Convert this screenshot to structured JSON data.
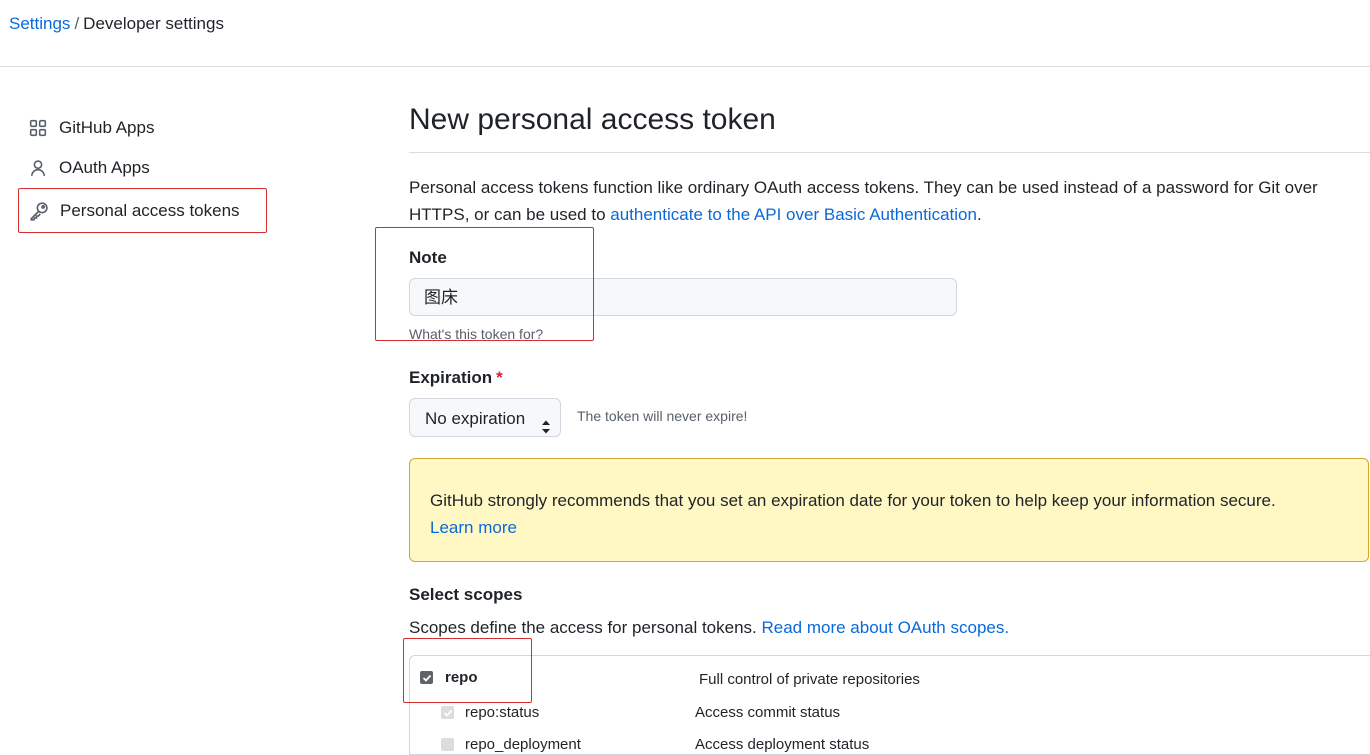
{
  "breadcrumb": {
    "root": "Settings",
    "separator": "/",
    "current": "Developer settings"
  },
  "sidebar": {
    "items": [
      {
        "label": "GitHub Apps",
        "icon": "apps-grid-icon"
      },
      {
        "label": "OAuth Apps",
        "icon": "person-icon"
      },
      {
        "label": "Personal access tokens",
        "icon": "key-icon",
        "active": true
      }
    ]
  },
  "main": {
    "title": "New personal access token",
    "intro_text": "Personal access tokens function like ordinary OAuth access tokens. They can be used instead of a password for Git over HTTPS, or can be used to ",
    "intro_link": "authenticate to the API over Basic Authentication",
    "intro_end": ".",
    "note": {
      "label": "Note",
      "value": "图床",
      "help": "What's this token for?"
    },
    "expiration": {
      "label": "Expiration",
      "required_mark": "*",
      "selected": "No expiration",
      "note": "The token will never expire!"
    },
    "warning": {
      "text": "GitHub strongly recommends that you set an expiration date for your token to help keep your information secure.",
      "link": "Learn more"
    },
    "scopes": {
      "label": "Select scopes",
      "desc": "Scopes define the access for personal tokens. ",
      "desc_link": "Read more about OAuth scopes.",
      "rows": [
        {
          "name": "repo",
          "desc": "Full control of private repositories",
          "checked": true
        },
        {
          "name": "repo:status",
          "desc": "Access commit status",
          "checked": true,
          "disabled": true
        },
        {
          "name": "repo_deployment",
          "desc": "Access deployment status",
          "checked": true,
          "disabled": true
        }
      ]
    }
  },
  "colors": {
    "link": "#0969da",
    "annotation": "#d32f2f",
    "warning_bg": "#fff8c5"
  }
}
